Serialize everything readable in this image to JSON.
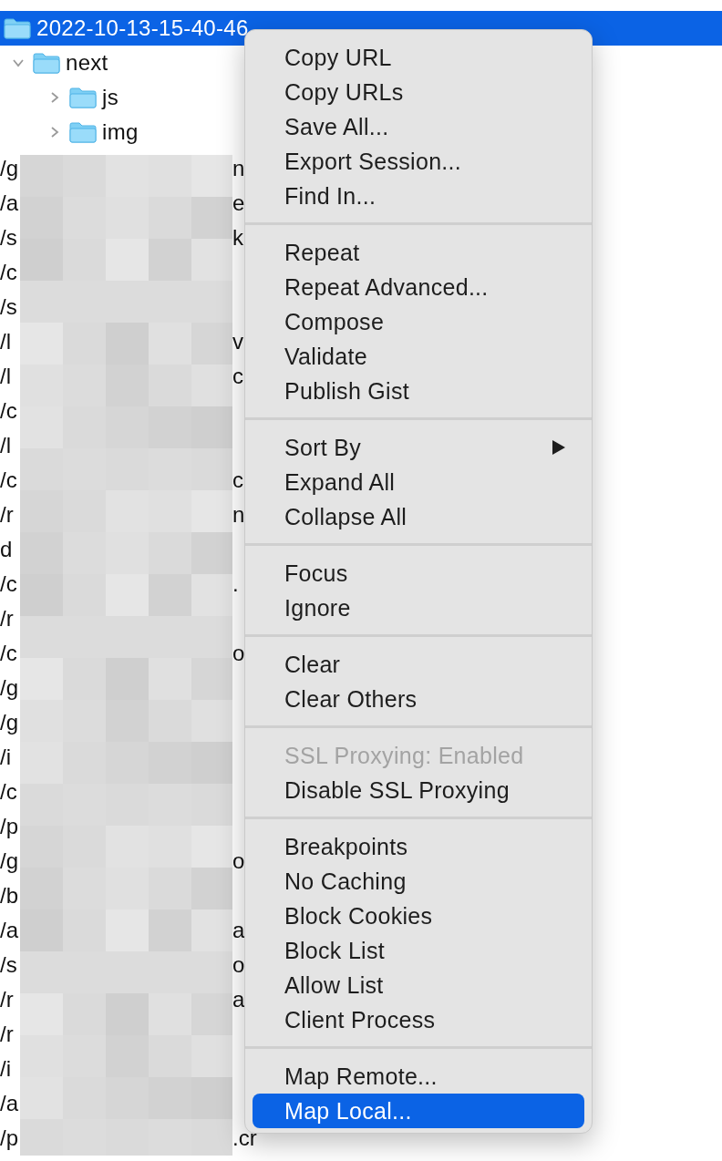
{
  "tree": [
    {
      "label": "2022-10-13-15-40-46",
      "selected": true,
      "children": [
        {
          "label": "next",
          "selected": false,
          "expanded": true,
          "children": [
            {
              "label": "js",
              "selected": false,
              "expanded": false
            },
            {
              "label": "img",
              "selected": false,
              "expanded": false
            }
          ]
        }
      ]
    }
  ],
  "rows": [
    {
      "start": "/g",
      "end": "n"
    },
    {
      "start": "/a",
      "end": "e"
    },
    {
      "start": "/s",
      "end": "k"
    },
    {
      "start": "/c"
    },
    {
      "start": "/s"
    },
    {
      "start": "/l",
      "end": "v"
    },
    {
      "start": "/l",
      "end": "c"
    },
    {
      "start": "/c"
    },
    {
      "start": "/l"
    },
    {
      "start": "/c",
      "end": "c"
    },
    {
      "start": "/r",
      "end": "n"
    },
    {
      "start": "d"
    },
    {
      "start": "/c",
      "end": "."
    },
    {
      "start": "/r"
    },
    {
      "start": "/c",
      "end": "o"
    },
    {
      "start": "/g"
    },
    {
      "start": "/g"
    },
    {
      "start": "/i"
    },
    {
      "start": "/c"
    },
    {
      "start": "/p"
    },
    {
      "start": "/g",
      "end": "o"
    },
    {
      "start": "/b"
    },
    {
      "start": "/a",
      "end": "a"
    },
    {
      "start": "/s",
      "end": "o"
    },
    {
      "start": "/r",
      "end": "a"
    },
    {
      "start": "/r"
    },
    {
      "start": "/i"
    },
    {
      "start": "/a"
    },
    {
      "start": "/p",
      "end": ".cr"
    }
  ],
  "menu": {
    "groups": [
      {
        "items": [
          {
            "label": "Copy URL",
            "disabled": false,
            "selected": false,
            "submenu": false
          },
          {
            "label": "Copy URLs",
            "disabled": false,
            "selected": false,
            "submenu": false
          },
          {
            "label": "Save All...",
            "disabled": false,
            "selected": false,
            "submenu": false
          },
          {
            "label": "Export Session...",
            "disabled": false,
            "selected": false,
            "submenu": false
          },
          {
            "label": "Find In...",
            "disabled": false,
            "selected": false,
            "submenu": false
          }
        ]
      },
      {
        "items": [
          {
            "label": "Repeat",
            "disabled": false,
            "selected": false,
            "submenu": false
          },
          {
            "label": "Repeat Advanced...",
            "disabled": false,
            "selected": false,
            "submenu": false
          },
          {
            "label": "Compose",
            "disabled": false,
            "selected": false,
            "submenu": false
          },
          {
            "label": "Validate",
            "disabled": false,
            "selected": false,
            "submenu": false
          },
          {
            "label": "Publish Gist",
            "disabled": false,
            "selected": false,
            "submenu": false
          }
        ]
      },
      {
        "items": [
          {
            "label": "Sort By",
            "disabled": false,
            "selected": false,
            "submenu": true
          },
          {
            "label": "Expand All",
            "disabled": false,
            "selected": false,
            "submenu": false
          },
          {
            "label": "Collapse All",
            "disabled": false,
            "selected": false,
            "submenu": false
          }
        ]
      },
      {
        "items": [
          {
            "label": "Focus",
            "disabled": false,
            "selected": false,
            "submenu": false
          },
          {
            "label": "Ignore",
            "disabled": false,
            "selected": false,
            "submenu": false
          }
        ]
      },
      {
        "items": [
          {
            "label": "Clear",
            "disabled": false,
            "selected": false,
            "submenu": false
          },
          {
            "label": "Clear Others",
            "disabled": false,
            "selected": false,
            "submenu": false
          }
        ]
      },
      {
        "items": [
          {
            "label": "SSL Proxying: Enabled",
            "disabled": true,
            "selected": false,
            "submenu": false
          },
          {
            "label": "Disable SSL Proxying",
            "disabled": false,
            "selected": false,
            "submenu": false
          }
        ]
      },
      {
        "items": [
          {
            "label": "Breakpoints",
            "disabled": false,
            "selected": false,
            "submenu": false
          },
          {
            "label": "No Caching",
            "disabled": false,
            "selected": false,
            "submenu": false
          },
          {
            "label": "Block Cookies",
            "disabled": false,
            "selected": false,
            "submenu": false
          },
          {
            "label": "Block List",
            "disabled": false,
            "selected": false,
            "submenu": false
          },
          {
            "label": "Allow List",
            "disabled": false,
            "selected": false,
            "submenu": false
          },
          {
            "label": "Client Process",
            "disabled": false,
            "selected": false,
            "submenu": false
          }
        ]
      },
      {
        "items": [
          {
            "label": "Map Remote...",
            "disabled": false,
            "selected": false,
            "submenu": false
          },
          {
            "label": "Map Local...",
            "disabled": false,
            "selected": true,
            "submenu": false
          }
        ]
      }
    ]
  }
}
